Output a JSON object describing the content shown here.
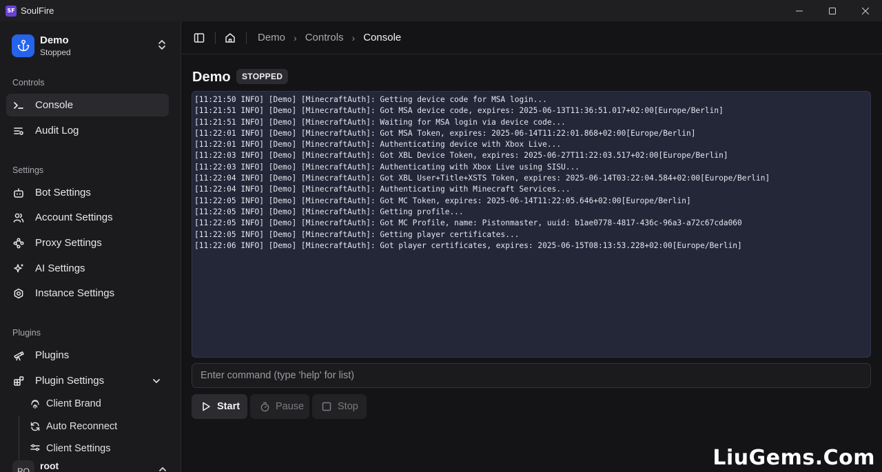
{
  "window": {
    "logo_text": "SF",
    "app_title": "SoulFire",
    "controls": [
      "minimize-icon",
      "maximize-icon",
      "close-icon"
    ]
  },
  "sidebar": {
    "instance": {
      "name": "Demo",
      "status": "Stopped"
    },
    "sections": {
      "controls": "Controls",
      "settings": "Settings",
      "plugins": "Plugins"
    },
    "controls_items": [
      {
        "label": "Console",
        "icon": "terminal-icon",
        "active": true
      },
      {
        "label": "Audit Log",
        "icon": "list-filter-icon",
        "active": false
      }
    ],
    "settings_items": [
      {
        "label": "Bot Settings",
        "icon": "bot-icon"
      },
      {
        "label": "Account Settings",
        "icon": "users-icon"
      },
      {
        "label": "Proxy Settings",
        "icon": "waypoints-icon"
      },
      {
        "label": "AI Settings",
        "icon": "sparkles-icon"
      },
      {
        "label": "Instance Settings",
        "icon": "hexagon-cog-icon"
      }
    ],
    "plugin_items": [
      {
        "label": "Plugins",
        "icon": "telescope-icon"
      },
      {
        "label": "Plugin Settings",
        "icon": "blocks-icon"
      }
    ],
    "plugin_sub_items": [
      {
        "label": "Client Brand",
        "icon": "fingerprint-icon"
      },
      {
        "label": "Auto Reconnect",
        "icon": "refresh-icon"
      },
      {
        "label": "Client Settings",
        "icon": "sliders-icon"
      }
    ],
    "user": {
      "initials": "RO",
      "name": "root"
    }
  },
  "topbar": {
    "breadcrumb": [
      "Demo",
      "Controls",
      "Console"
    ]
  },
  "main": {
    "title": "Demo",
    "status_badge": "STOPPED",
    "log_lines": [
      "[11:21:50 INFO] [Demo] [MinecraftAuth]: Getting device code for MSA login...",
      "[11:21:51 INFO] [Demo] [MinecraftAuth]: Got MSA device code, expires: 2025-06-13T11:36:51.017+02:00[Europe/Berlin]",
      "[11:21:51 INFO] [Demo] [MinecraftAuth]: Waiting for MSA login via device code...",
      "[11:22:01 INFO] [Demo] [MinecraftAuth]: Got MSA Token, expires: 2025-06-14T11:22:01.868+02:00[Europe/Berlin]",
      "[11:22:01 INFO] [Demo] [MinecraftAuth]: Authenticating device with Xbox Live...",
      "[11:22:03 INFO] [Demo] [MinecraftAuth]: Got XBL Device Token, expires: 2025-06-27T11:22:03.517+02:00[Europe/Berlin]",
      "[11:22:03 INFO] [Demo] [MinecraftAuth]: Authenticating with Xbox Live using SISU...",
      "[11:22:04 INFO] [Demo] [MinecraftAuth]: Got XBL User+Title+XSTS Token, expires: 2025-06-14T03:22:04.584+02:00[Europe/Berlin]",
      "[11:22:04 INFO] [Demo] [MinecraftAuth]: Authenticating with Minecraft Services...",
      "[11:22:05 INFO] [Demo] [MinecraftAuth]: Got MC Token, expires: 2025-06-14T11:22:05.646+02:00[Europe/Berlin]",
      "[11:22:05 INFO] [Demo] [MinecraftAuth]: Getting profile...",
      "[11:22:05 INFO] [Demo] [MinecraftAuth]: Got MC Profile, name: Pistonmaster, uuid: b1ae0778-4817-436c-96a3-a72c67cda060",
      "[11:22:05 INFO] [Demo] [MinecraftAuth]: Getting player certificates...",
      "[11:22:06 INFO] [Demo] [MinecraftAuth]: Got player certificates, expires: 2025-06-15T08:13:53.228+02:00[Europe/Berlin]"
    ],
    "command": {
      "placeholder": "Enter command (type 'help' for list)",
      "value": ""
    },
    "buttons": {
      "start": "Start",
      "pause": "Pause",
      "stop": "Stop"
    }
  },
  "watermark": "LiuGems.Com"
}
